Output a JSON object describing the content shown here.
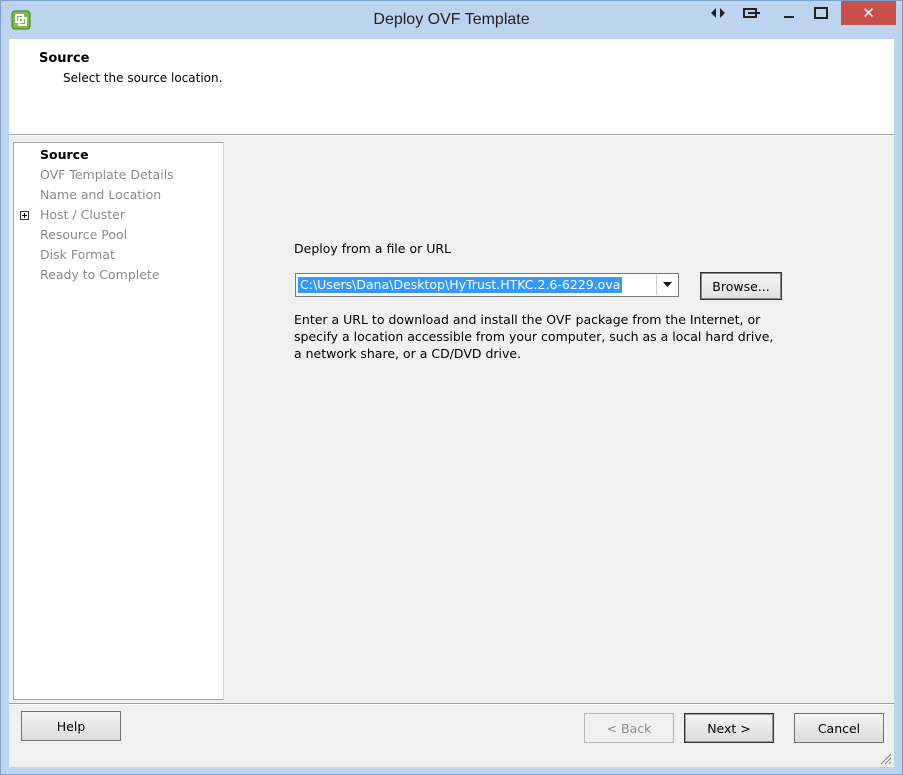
{
  "window": {
    "title": "Deploy OVF Template",
    "close_glyph": "✕"
  },
  "header": {
    "title": "Source",
    "subtitle": "Select the source location."
  },
  "steps": [
    {
      "label": "Source",
      "active": true
    },
    {
      "label": "OVF Template Details",
      "active": false
    },
    {
      "label": "Name and Location",
      "active": false
    },
    {
      "label": "Host / Cluster",
      "active": false,
      "expandable": true
    },
    {
      "label": "Resource Pool",
      "active": false
    },
    {
      "label": "Disk Format",
      "active": false
    },
    {
      "label": "Ready to Complete",
      "active": false
    }
  ],
  "source": {
    "deploy_label": "Deploy from a file or URL",
    "path_value": "C:\\Users\\Dana\\Desktop\\HyTrust.HTKC.2.6-6229.ova",
    "browse_label": "Browse...",
    "help_text": "Enter a URL to download and install the OVF package from the Internet, or specify a location accessible from your computer, such as a local hard drive, a network share, or a CD/DVD drive."
  },
  "footer": {
    "help_label": "Help",
    "back_label": "< Back",
    "next_label": "Next >",
    "cancel_label": "Cancel"
  },
  "colors": {
    "accent": "#3399ff",
    "close": "#c7504b",
    "frame": "#bcd4ee"
  }
}
